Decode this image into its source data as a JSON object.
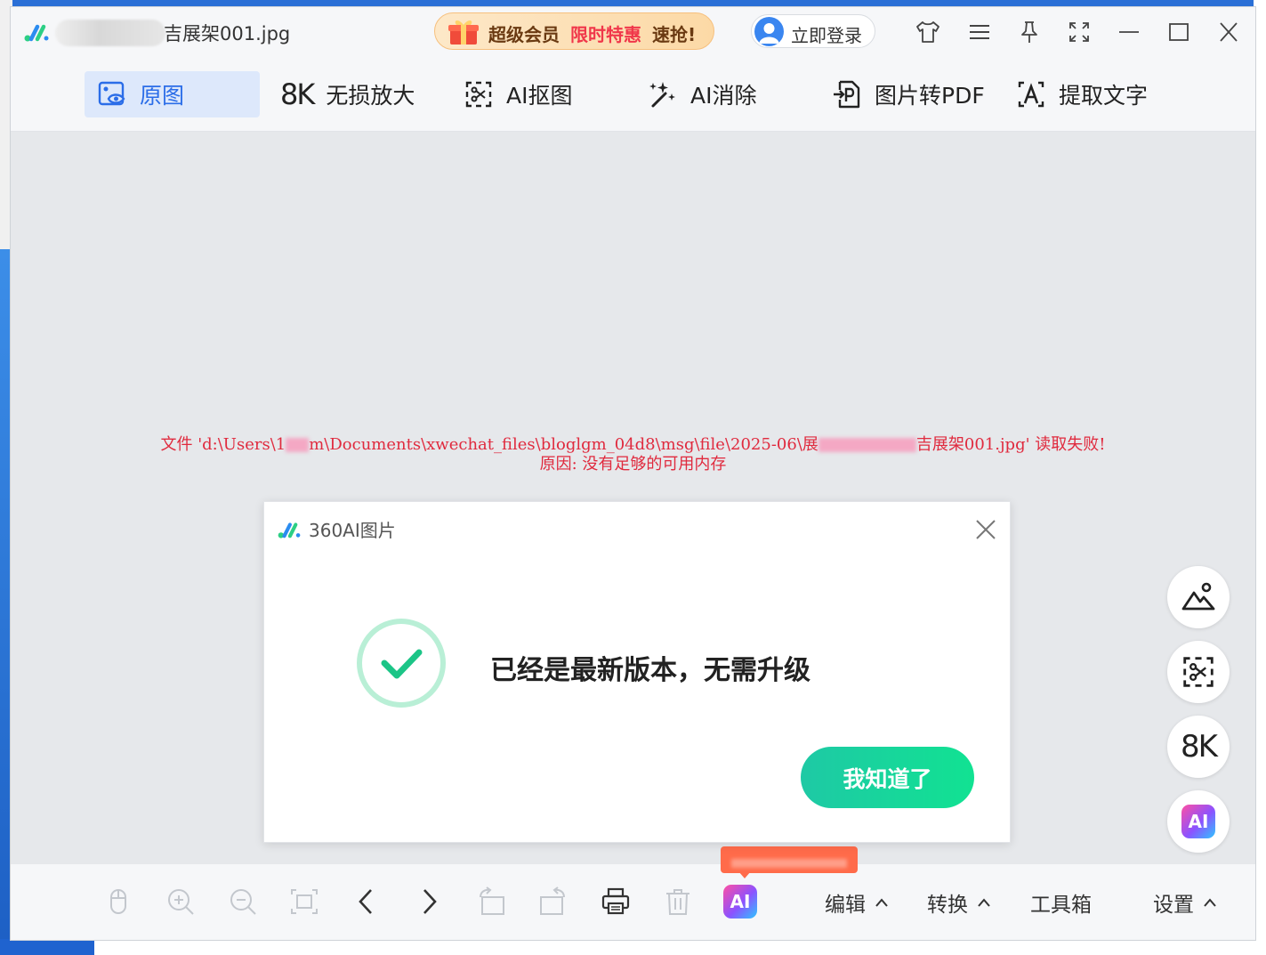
{
  "window": {
    "filename": "吉展架001.jpg"
  },
  "promo": {
    "part1": "超级会员",
    "part2": "限时特惠",
    "part3": "速抢!"
  },
  "login": {
    "label": "立即登录"
  },
  "tabs": [
    {
      "label": "原图",
      "icon": "image-eye-icon",
      "active": true
    },
    {
      "label": "无损放大",
      "icon": "8k-icon",
      "active": false
    },
    {
      "label": "AI抠图",
      "icon": "cutout-icon",
      "active": false
    },
    {
      "label": "AI消除",
      "icon": "magic-wand-icon",
      "active": false
    },
    {
      "label": "图片转PDF",
      "icon": "pdf-icon",
      "active": false
    },
    {
      "label": "提取文字",
      "icon": "text-extract-icon",
      "active": false
    }
  ],
  "k8_label": "8K",
  "error": {
    "line1_a": "文件 'd:\\Users\\1",
    "line1_b": "m\\Documents\\xwechat_files\\bloglgm_04d8\\msg\\file\\2025-06\\展",
    "line1_c": "吉展架001.jpg' 读取失败!",
    "line2": "原因: 没有足够的可用内存"
  },
  "dialog": {
    "title": "360AI图片",
    "message": "已经是最新版本，无需升级",
    "ok_label": "我知道了"
  },
  "side_buttons": {
    "ai_label": "AI"
  },
  "bottom": {
    "ai_label": "AI",
    "menus": [
      {
        "label": "编辑"
      },
      {
        "label": "转换"
      },
      {
        "label": "工具箱"
      },
      {
        "label": "设置"
      }
    ]
  },
  "colors": {
    "accent_blue": "#2b6de8",
    "error_red": "#e02a3e",
    "ok_green": "#1ec9a5",
    "promo_red": "#f0374a"
  }
}
